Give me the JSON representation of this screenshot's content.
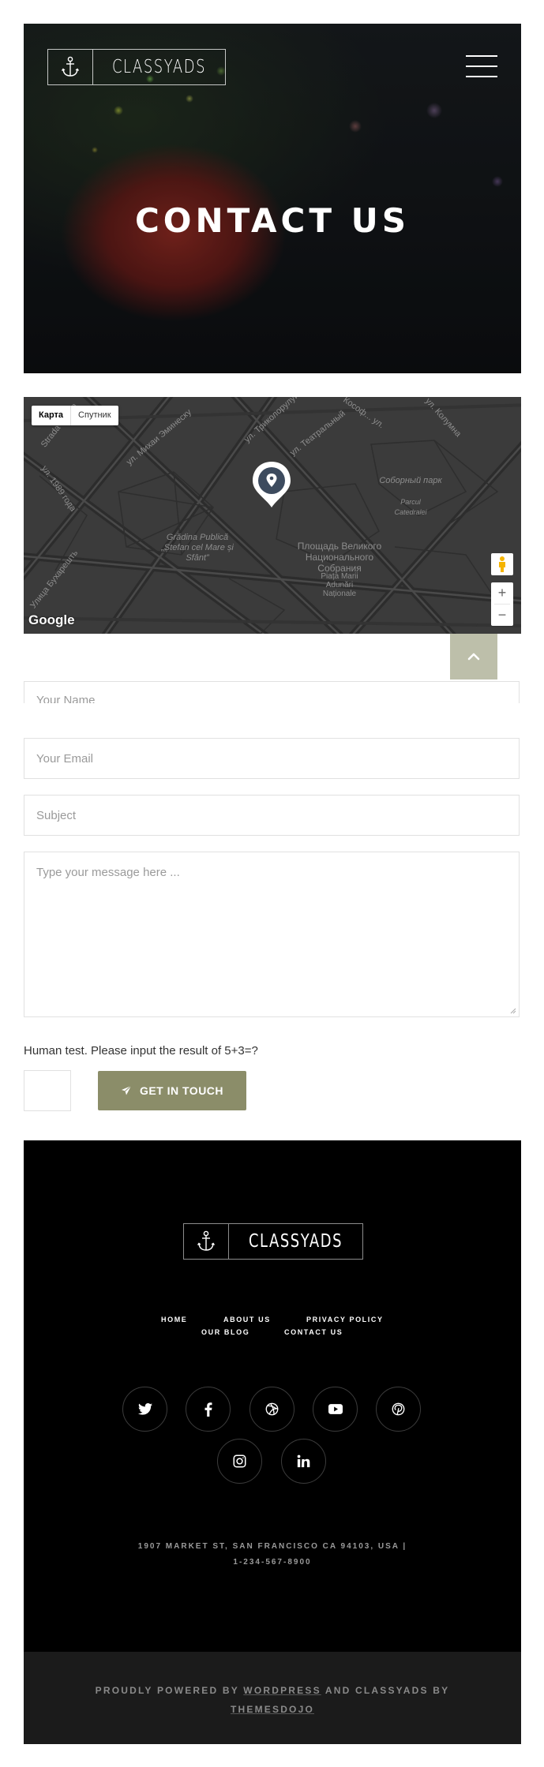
{
  "header": {
    "brand": "CLASSYADS",
    "page_title": "CONTACT US"
  },
  "map": {
    "toggle_map": "Карта",
    "toggle_satellite": "Спутник",
    "labels": {
      "street_strada": "Strada Stefan",
      "street_1989": "ул. 1989 года",
      "street_mihai": "ул. Михаи Эминеску",
      "street_trikolor": "ул. Триколорулуй",
      "street_teatralny": "ул. Театральный",
      "street_kosoft": "Кософ... ул.",
      "street_kolumna": "ул. Колумна",
      "street_bukureshti": "Улица Бухарешть",
      "park_sobor": "Соборный парк",
      "park_parcul": "Parcul Catedralei",
      "gradina": "Grădina Publică „Ștefan cel Mare și Sfânt”",
      "square_ru": "Площадь Великого Национального Собрания",
      "square_ro": "Piața Marii Adunări Naționale"
    },
    "google": "Google"
  },
  "form": {
    "name_placeholder": "Your Name",
    "email_placeholder": "Your Email",
    "subject_placeholder": "Subject",
    "message_placeholder": "Type your message here ...",
    "human_test": "Human test. Please input the result of 5+3=?",
    "submit_label": "GET IN TOUCH"
  },
  "footer": {
    "brand": "CLASSYADS",
    "nav": {
      "home": "HOME",
      "about": "ABOUT US",
      "privacy": "PRIVACY POLICY",
      "blog": "OUR BLOG",
      "contact": "CONTACT US"
    },
    "social": [
      "twitter-icon",
      "facebook-icon",
      "dribbble-icon",
      "youtube-icon",
      "pinterest-icon",
      "instagram-icon",
      "linkedin-icon"
    ],
    "address_line1": "1907 MARKET ST, SAN FRANCISCO CA 94103, USA |",
    "address_line2": "1-234-567-8900",
    "copyright_prefix": "PROUDLY POWERED BY",
    "copyright_wordpress": "WORDPRESS",
    "copyright_middle": "AND CLASSYADS BY",
    "copyright_themesdojo": "THEMESDOJO"
  },
  "colors": {
    "accent": "#8b8d69",
    "scroll_top": "#bdbfaa",
    "footer_bg": "#000000",
    "copyright_bg": "#1b1b1b"
  }
}
